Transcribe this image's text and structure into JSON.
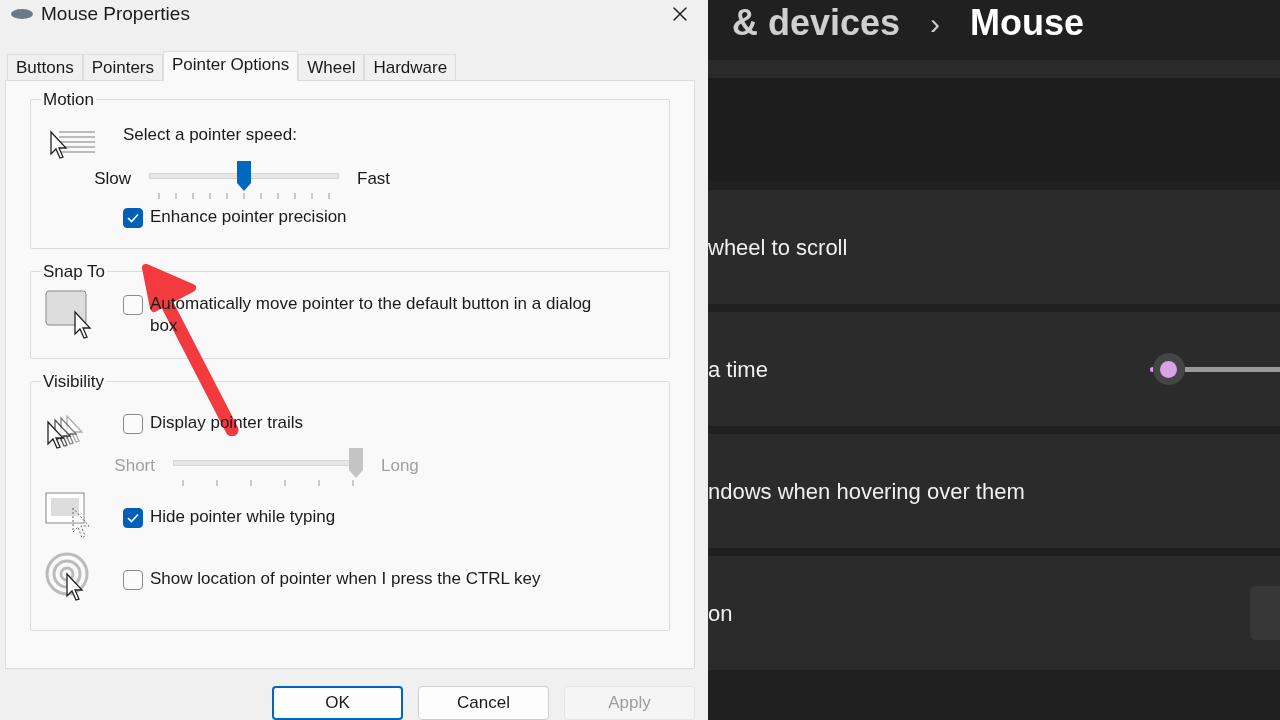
{
  "window": {
    "title": "Mouse Properties"
  },
  "tabs": [
    {
      "label": "Buttons",
      "selected": false
    },
    {
      "label": "Pointers",
      "selected": false
    },
    {
      "label": "Pointer Options",
      "selected": true
    },
    {
      "label": "Wheel",
      "selected": false
    },
    {
      "label": "Hardware",
      "selected": false
    }
  ],
  "motion": {
    "legend": "Motion",
    "prompt": "Select a pointer speed:",
    "speed": {
      "min_label": "Slow",
      "max_label": "Fast",
      "level": 0.5,
      "disabled": false
    },
    "enhance": {
      "label": "Enhance pointer precision",
      "checked": true
    }
  },
  "snap_to": {
    "legend": "Snap To",
    "checkbox": {
      "label": "Automatically move pointer to the default button in a dialog box",
      "checked": false
    }
  },
  "visibility": {
    "legend": "Visibility",
    "trails": {
      "label": "Display pointer trails",
      "checked": false
    },
    "trail_length": {
      "min_label": "Short",
      "max_label": "Long",
      "level": 1,
      "disabled": true
    },
    "hide_while_typing": {
      "label": "Hide pointer while typing",
      "checked": true
    },
    "show_location": {
      "label": "Show location of pointer when I press the CTRL key",
      "checked": false
    }
  },
  "buttons": [
    {
      "label": "OK",
      "default": true,
      "disabled": false
    },
    {
      "label": "Cancel",
      "default": false,
      "disabled": false
    },
    {
      "label": "Apply",
      "default": false,
      "disabled": true
    }
  ],
  "background": {
    "breadcrumb": [
      "& devices",
      "Mouse"
    ],
    "separator": "›",
    "cards": [
      {
        "kind": "blank"
      },
      {
        "kind": "text",
        "text": "wheel to scroll"
      },
      {
        "kind": "slider",
        "text": "a time",
        "level": 0.02
      },
      {
        "kind": "text",
        "text": "ndows when hovering over them"
      },
      {
        "kind": "button",
        "text": "on"
      }
    ]
  }
}
